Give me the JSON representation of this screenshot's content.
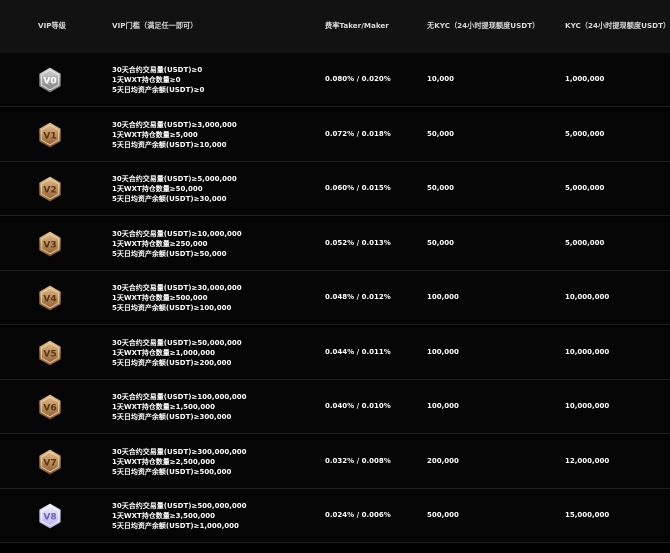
{
  "headers": {
    "level": "VIP等级",
    "threshold": "VIP门槛（满足任一即可）",
    "rate": "费率Taker/Maker",
    "no_kyc": "无KYC（24小时提现额度USDT）",
    "kyc": "KYC（24小时提现额度USDT）"
  },
  "rows": [
    {
      "badge": "V0",
      "badge_number": "0",
      "badge_style": "silver",
      "futures_volume": "30天合约交易量(USDT)≥0",
      "wxt_holding": "1天WXT持仓数量≥0",
      "asset_balance": "5天日均资产余额(USDT)≥0",
      "rate": "0.080% / 0.020%",
      "no_kyc": "10,000",
      "kyc": "1,000,000"
    },
    {
      "badge": "V1",
      "badge_number": "1",
      "badge_style": "bronze",
      "futures_volume": "30天合约交易量(USDT)≥3,000,000",
      "wxt_holding": "1天WXT持仓数量≥5,000",
      "asset_balance": "5天日均资产余额(USDT)≥10,000",
      "rate": "0.072% / 0.018%",
      "no_kyc": "50,000",
      "kyc": "5,000,000"
    },
    {
      "badge": "V2",
      "badge_number": "2",
      "badge_style": "bronze",
      "futures_volume": "30天合约交易量(USDT)≥5,000,000",
      "wxt_holding": "1天WXT持仓数量≥50,000",
      "asset_balance": "5天日均资产余额(USDT)≥30,000",
      "rate": "0.060% / 0.015%",
      "no_kyc": "50,000",
      "kyc": "5,000,000"
    },
    {
      "badge": "V3",
      "badge_number": "3",
      "badge_style": "bronze",
      "futures_volume": "30天合约交易量(USDT)≥10,000,000",
      "wxt_holding": "1天WXT持仓数量≥250,000",
      "asset_balance": "5天日均资产余额(USDT)≥50,000",
      "rate": "0.052% / 0.013%",
      "no_kyc": "50,000",
      "kyc": "5,000,000"
    },
    {
      "badge": "V4",
      "badge_number": "4",
      "badge_style": "bronze",
      "futures_volume": "30天合约交易量(USDT)≥30,000,000",
      "wxt_holding": "1天WXT持仓数量≥500,000",
      "asset_balance": "5天日均资产余额(USDT)≥100,000",
      "rate": "0.048% / 0.012%",
      "no_kyc": "100,000",
      "kyc": "10,000,000"
    },
    {
      "badge": "V5",
      "badge_number": "5",
      "badge_style": "bronze",
      "futures_volume": "30天合约交易量(USDT)≥50,000,000",
      "wxt_holding": "1天WXT持仓数量≥1,000,000",
      "asset_balance": "5天日均资产余额(USDT)≥200,000",
      "rate": "0.044% / 0.011%",
      "no_kyc": "100,000",
      "kyc": "10,000,000"
    },
    {
      "badge": "V6",
      "badge_number": "6",
      "badge_style": "bronze",
      "futures_volume": "30天合约交易量(USDT)≥100,000,000",
      "wxt_holding": "1天WXT持仓数量≥1,500,000",
      "asset_balance": "5天日均资产余额(USDT)≥300,000",
      "rate": "0.040% / 0.010%",
      "no_kyc": "100,000",
      "kyc": "10,000,000"
    },
    {
      "badge": "V7",
      "badge_number": "7",
      "badge_style": "bronze",
      "futures_volume": "30天合约交易量(USDT)≥300,000,000",
      "wxt_holding": "1天WXT持仓数量≥2,500,000",
      "asset_balance": "5天日均资产余额(USDT)≥500,000",
      "rate": "0.032% / 0.008%",
      "no_kyc": "200,000",
      "kyc": "12,000,000"
    },
    {
      "badge": "V8",
      "badge_number": "8",
      "badge_style": "diamond",
      "futures_volume": "30天合约交易量(USDT)≥500,000,000",
      "wxt_holding": "1天WXT持仓数量≥3,500,000",
      "asset_balance": "5天日均资产余额(USDT)≥1,000,000",
      "rate": "0.024% / 0.006%",
      "no_kyc": "500,000",
      "kyc": "15,000,000"
    }
  ],
  "colors": {
    "background": "#000000",
    "header_background": "#121212",
    "text": "#ffffff",
    "header_text": "#d8d8d8",
    "row_divider": "#1f1f1f",
    "silver_light": "#d9d9d9",
    "silver_dark": "#7a7a7a",
    "bronze_light": "#e8c28c",
    "bronze_dark": "#8a5a2e",
    "bronze_text": "#5a3614",
    "diamond_light": "#eef0ff",
    "diamond_dark": "#b7b3ea",
    "diamond_text": "#6a5fc0"
  }
}
